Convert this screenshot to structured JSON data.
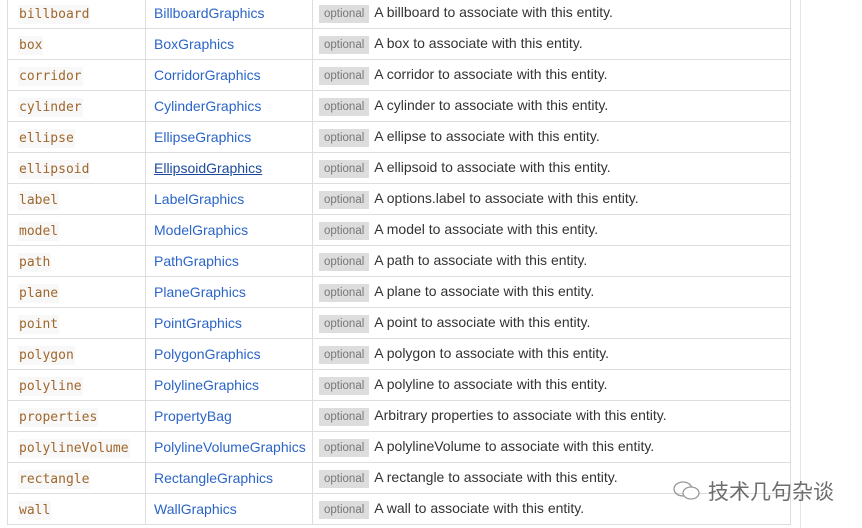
{
  "rows": [
    {
      "name": "billboard",
      "type": "BillboardGraphics",
      "badge": "optional",
      "desc": "A billboard to associate with this entity."
    },
    {
      "name": "box",
      "type": "BoxGraphics",
      "badge": "optional",
      "desc": "A box to associate with this entity."
    },
    {
      "name": "corridor",
      "type": "CorridorGraphics",
      "badge": "optional",
      "desc": "A corridor to associate with this entity."
    },
    {
      "name": "cylinder",
      "type": "CylinderGraphics",
      "badge": "optional",
      "desc": "A cylinder to associate with this entity."
    },
    {
      "name": "ellipse",
      "type": "EllipseGraphics",
      "badge": "optional",
      "desc": "A ellipse to associate with this entity."
    },
    {
      "name": "ellipsoid",
      "type": "EllipsoidGraphics",
      "badge": "optional",
      "desc": "A ellipsoid to associate with this entity.",
      "hovered": true
    },
    {
      "name": "label",
      "type": "LabelGraphics",
      "badge": "optional",
      "desc": "A options.label to associate with this entity."
    },
    {
      "name": "model",
      "type": "ModelGraphics",
      "badge": "optional",
      "desc": "A model to associate with this entity."
    },
    {
      "name": "path",
      "type": "PathGraphics",
      "badge": "optional",
      "desc": "A path to associate with this entity."
    },
    {
      "name": "plane",
      "type": "PlaneGraphics",
      "badge": "optional",
      "desc": "A plane to associate with this entity."
    },
    {
      "name": "point",
      "type": "PointGraphics",
      "badge": "optional",
      "desc": "A point to associate with this entity."
    },
    {
      "name": "polygon",
      "type": "PolygonGraphics",
      "badge": "optional",
      "desc": "A polygon to associate with this entity."
    },
    {
      "name": "polyline",
      "type": "PolylineGraphics",
      "badge": "optional",
      "desc": "A polyline to associate with this entity."
    },
    {
      "name": "properties",
      "type": "PropertyBag",
      "badge": "optional",
      "desc": "Arbitrary properties to associate with this entity."
    },
    {
      "name": "polylineVolume",
      "type": "PolylineVolumeGraphics",
      "badge": "optional",
      "desc": "A polylineVolume to associate with this entity."
    },
    {
      "name": "rectangle",
      "type": "RectangleGraphics",
      "badge": "optional",
      "desc": "A rectangle to associate with this entity."
    },
    {
      "name": "wall",
      "type": "WallGraphics",
      "badge": "optional",
      "desc": "A wall to associate with this entity."
    }
  ],
  "watermark": {
    "text": "技术几句杂谈",
    "icon": "wechat-icon"
  }
}
